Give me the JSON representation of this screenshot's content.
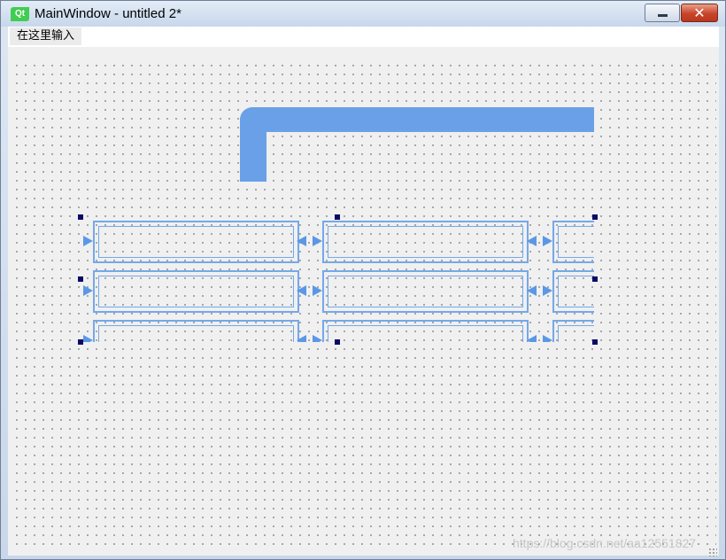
{
  "window": {
    "title": "MainWindow - untitled 2*",
    "logo_text": "Qt",
    "minimize_glyph": "",
    "close_glyph": "✕"
  },
  "menubar": {
    "items": [
      {
        "label": "在这里输入"
      }
    ]
  },
  "designer": {
    "grid_layout": {
      "rows": 3,
      "columns": 3
    },
    "accent_color": "#6aa0e8",
    "handle_color": "#0b0b66"
  },
  "watermark": "https://blog.csdn.net/aa12551827"
}
